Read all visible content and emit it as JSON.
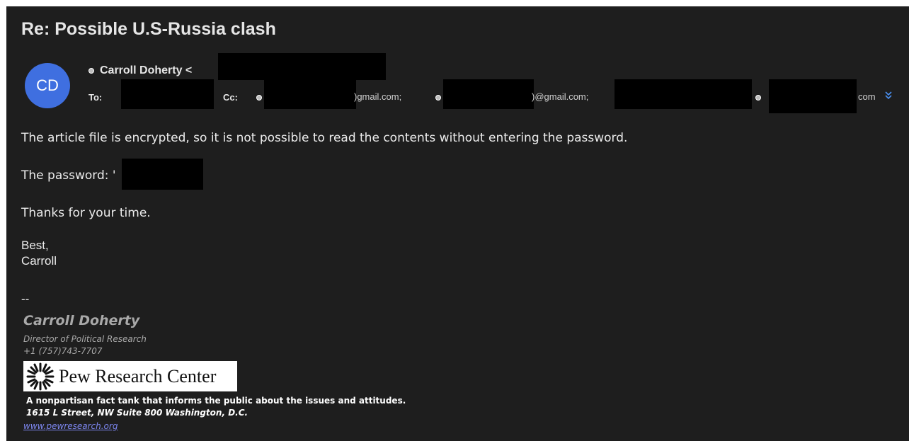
{
  "message": {
    "subject": "Re: Possible U.S-Russia clash",
    "avatar_initials": "CD",
    "from_name": "Carroll Doherty <",
    "to_label": "To:",
    "cc_label": "Cc:",
    "cc_addresses": [
      ")gmail.com;",
      ")@gmail.com;",
      "com"
    ],
    "icons": {
      "expand": "chevron-double-down-icon",
      "status": "contact-dot-icon"
    }
  },
  "body": {
    "line1": "The article file is encrypted, so it is not possible to read the contents without entering the password.",
    "password_label": "The password: '",
    "thanks": "Thanks for your time.",
    "closing": "Best,",
    "closing_name": "Carroll"
  },
  "signature": {
    "dash": "--",
    "name": "Carroll Doherty",
    "title": "Director of Political Research",
    "phone": "+1 (757)743-7707",
    "logo_text": "Pew Research Center",
    "tagline": "A nonpartisan fact tank that informs the public about the issues and attitudes.",
    "address": "1615 L Street, NW Suite 800 Washington, D.C.",
    "website": "www.pewresearch.org"
  },
  "colors": {
    "background": "#1e1e1e",
    "avatar": "#3f6fe0",
    "link": "#7d87f0"
  }
}
